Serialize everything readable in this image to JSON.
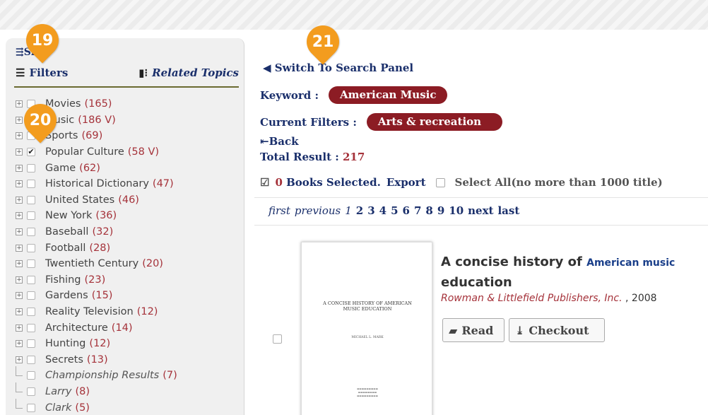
{
  "sidebar": {
    "skip_text": "Sk",
    "filters_tab": "Filters",
    "related_tab": "Related Topics",
    "facets": [
      {
        "label": "Movies",
        "count": "(165)",
        "checked": false,
        "sub": false
      },
      {
        "label": "Music",
        "count": "(186 V)",
        "checked": false,
        "sub": false
      },
      {
        "label": "Sports",
        "count": "(69)",
        "checked": false,
        "sub": false
      },
      {
        "label": "Popular Culture",
        "count": "(58 V)",
        "checked": true,
        "sub": false
      },
      {
        "label": "Game",
        "count": "(62)",
        "checked": false,
        "sub": false
      },
      {
        "label": "Historical Dictionary",
        "count": "(47)",
        "checked": false,
        "sub": false
      },
      {
        "label": "United States",
        "count": "(46)",
        "checked": false,
        "sub": false
      },
      {
        "label": "New York",
        "count": "(36)",
        "checked": false,
        "sub": false
      },
      {
        "label": "Baseball",
        "count": "(32)",
        "checked": false,
        "sub": false
      },
      {
        "label": "Football",
        "count": "(28)",
        "checked": false,
        "sub": false
      },
      {
        "label": "Twentieth Century",
        "count": "(20)",
        "checked": false,
        "sub": false
      },
      {
        "label": "Fishing",
        "count": "(23)",
        "checked": false,
        "sub": false
      },
      {
        "label": "Gardens",
        "count": "(15)",
        "checked": false,
        "sub": false
      },
      {
        "label": "Reality Television",
        "count": "(12)",
        "checked": false,
        "sub": false
      },
      {
        "label": "Architecture",
        "count": "(14)",
        "checked": false,
        "sub": false
      },
      {
        "label": "Hunting",
        "count": "(12)",
        "checked": false,
        "sub": false
      },
      {
        "label": "Secrets",
        "count": "(13)",
        "checked": false,
        "sub": false
      },
      {
        "label": "Championship Results",
        "count": "(7)",
        "checked": false,
        "sub": true
      },
      {
        "label": "Larry",
        "count": "(8)",
        "checked": false,
        "sub": true
      },
      {
        "label": "Clark",
        "count": "(5)",
        "checked": false,
        "sub": true
      }
    ]
  },
  "main": {
    "switch_link": "Switch To Search Panel",
    "keyword_label": "Keyword :",
    "keyword_value": "American Music",
    "filters_label": "Current Filters :",
    "filters_value": "Arts & recreation",
    "back_link": "Back",
    "total_label": "Total Result :",
    "total_value": "217",
    "selected_count": "0",
    "selected_text": "Books Selected.",
    "export_link": "Export",
    "select_all": "Select All(no more than 1000 title)"
  },
  "pager": {
    "first": "first",
    "previous": "previous",
    "current": "1",
    "pages": [
      "2",
      "3",
      "4",
      "5",
      "6",
      "7",
      "8",
      "9",
      "10"
    ],
    "next": "next",
    "last": "last"
  },
  "result": {
    "title_prefix": "A concise history of",
    "title_keyword": "American music",
    "title_suffix": "education",
    "publisher": "Rowman & Littlefield Publishers, Inc.",
    "year": ", 2008",
    "cover_title": "A CONCISE HISTORY OF AMERICAN MUSIC EDUCATION",
    "cover_author": "MICHAEL L. MARK",
    "read_label": "Read",
    "checkout_label": "Checkout"
  },
  "badges": {
    "b19": "19",
    "b20": "20",
    "b21": "21"
  },
  "colors": {
    "accent_pill": "#8c1c24",
    "link": "#1a2f6b",
    "count": "#a5323a",
    "badge": "#f39c1e"
  }
}
